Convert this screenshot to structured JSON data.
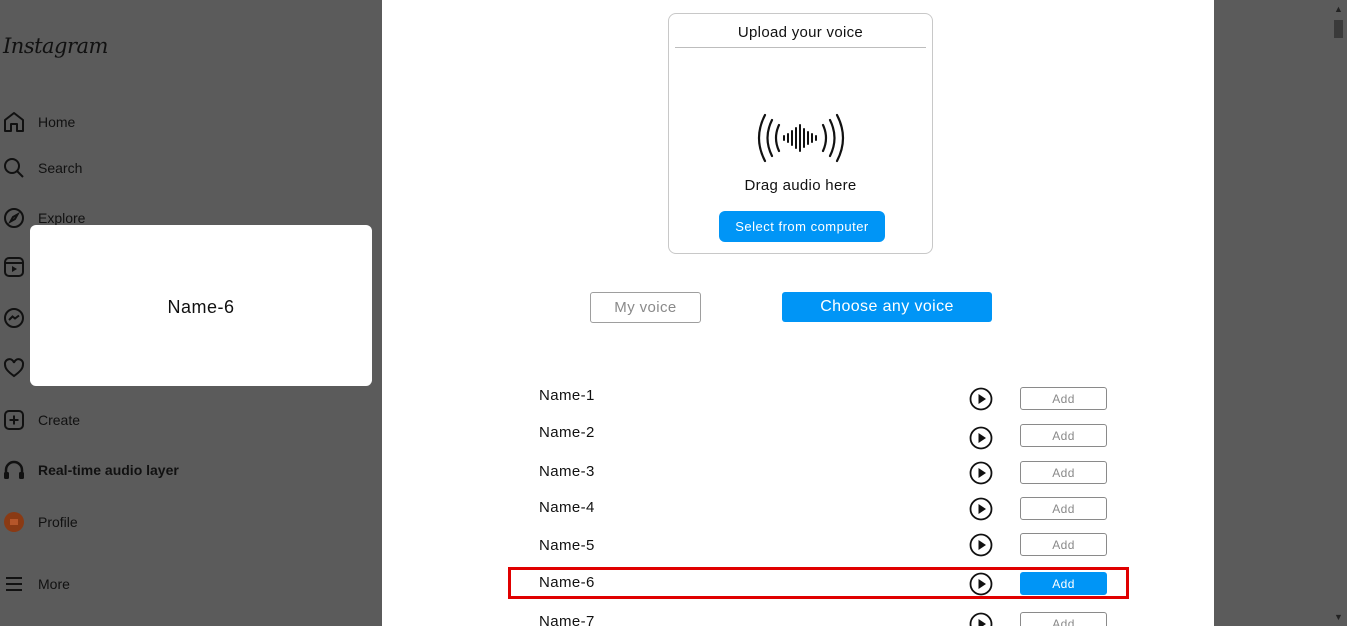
{
  "sidebar": {
    "logo": "Instagram",
    "items": [
      {
        "label": "Home",
        "icon": "home-icon"
      },
      {
        "label": "Search",
        "icon": "search-icon"
      },
      {
        "label": "Explore",
        "icon": "compass-icon"
      },
      {
        "label": "Reels",
        "icon": "reels-icon"
      },
      {
        "label": "Messages",
        "icon": "messenger-icon"
      },
      {
        "label": "Notifications",
        "icon": "heart-icon"
      },
      {
        "label": "Create",
        "icon": "plus-square-icon"
      },
      {
        "label": "Real-time audio layer",
        "icon": "headphones-icon"
      },
      {
        "label": "Profile",
        "icon": "avatar-icon"
      },
      {
        "label": "More",
        "icon": "menu-icon"
      }
    ]
  },
  "upload": {
    "title": "Upload your voice",
    "drag_text": "Drag audio here",
    "select_button": "Select from computer"
  },
  "tabs": {
    "my_voice": "My voice",
    "choose_any": "Choose any voice"
  },
  "voices": [
    {
      "name": "Name-1",
      "add_label": "Add",
      "selected": false
    },
    {
      "name": "Name-2",
      "add_label": "Add",
      "selected": false
    },
    {
      "name": "Name-3",
      "add_label": "Add",
      "selected": false
    },
    {
      "name": "Name-4",
      "add_label": "Add",
      "selected": false
    },
    {
      "name": "Name-5",
      "add_label": "Add",
      "selected": false
    },
    {
      "name": "Name-6",
      "add_label": "Add",
      "selected": true
    },
    {
      "name": "Name-7",
      "add_label": "Add",
      "selected": false
    }
  ],
  "popup": {
    "text": "Name-6"
  },
  "colors": {
    "accent": "#0095f6",
    "highlight": "#e00000",
    "overlay": "#5b5b5b"
  }
}
